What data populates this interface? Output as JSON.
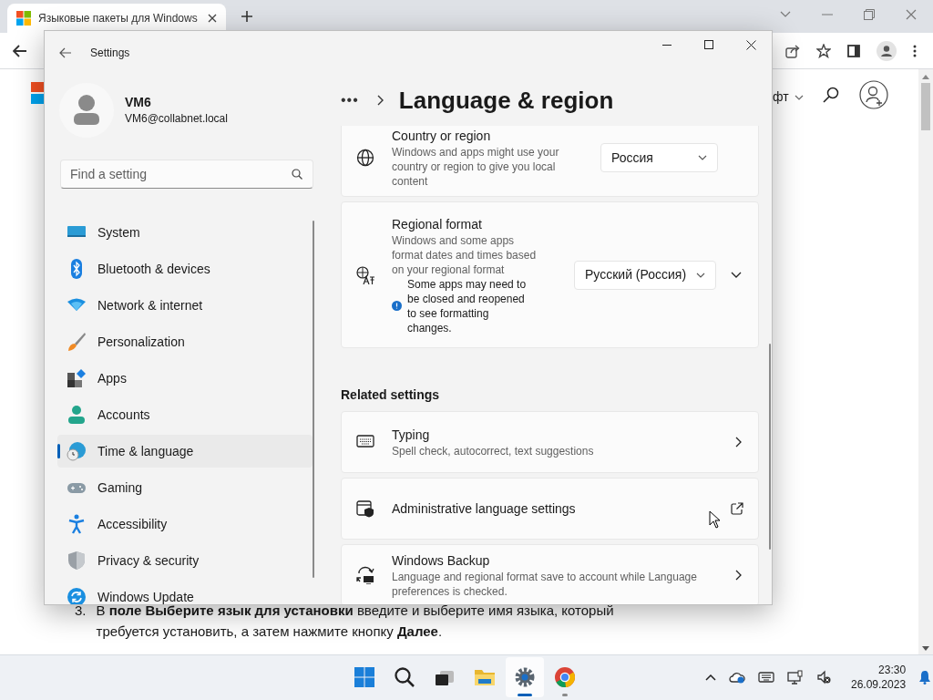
{
  "browser": {
    "tab": {
      "title": "Языковые пакеты для Windows"
    },
    "page": {
      "menu_text": "фт",
      "step_number": "3.",
      "step_text": "В **поле Выберите язык для установки** введите и выберите имя языка, который требуется установить, а затем нажмите кнопку **Далее**."
    }
  },
  "settings": {
    "title": "Settings",
    "user": {
      "name": "VM6",
      "email": "VM6@collabnet.local"
    },
    "search": {
      "placeholder": "Find a setting"
    },
    "nav": [
      {
        "label": "System",
        "selected": false
      },
      {
        "label": "Bluetooth & devices",
        "selected": false
      },
      {
        "label": "Network & internet",
        "selected": false
      },
      {
        "label": "Personalization",
        "selected": false
      },
      {
        "label": "Apps",
        "selected": false
      },
      {
        "label": "Accounts",
        "selected": false
      },
      {
        "label": "Time & language",
        "selected": true
      },
      {
        "label": "Gaming",
        "selected": false
      },
      {
        "label": "Accessibility",
        "selected": false
      },
      {
        "label": "Privacy & security",
        "selected": false
      },
      {
        "label": "Windows Update",
        "selected": false
      }
    ],
    "breadcrumb_more": "•••",
    "page_title": "Language & region",
    "region_cards": [
      {
        "title": "Country or region",
        "description": "Windows and apps might use your country or region to give you local content",
        "value": "Россия"
      },
      {
        "title": "Regional format",
        "description": "Windows and some apps format dates and times based on your regional format",
        "note": "Some apps may need to be closed and reopened to see formatting changes.",
        "value": "Русский (Россия)",
        "expanded": false
      }
    ],
    "related_heading": "Related settings",
    "related": [
      {
        "title": "Typing",
        "description": "Spell check, autocorrect, text suggestions",
        "kind": "chevron"
      },
      {
        "title": "Administrative language settings",
        "kind": "external"
      },
      {
        "title": "Windows Backup",
        "description": "Language and regional format save to account while Language preferences is checked.",
        "kind": "chevron"
      }
    ]
  },
  "taskbar": {
    "apps": [
      {
        "selected": false,
        "running": false
      },
      {
        "selected": false,
        "running": false
      },
      {
        "selected": false,
        "running": false
      },
      {
        "selected": false,
        "running": false
      },
      {
        "selected": true,
        "running": true
      },
      {
        "selected": false,
        "running": true
      }
    ],
    "clock": {
      "time": "23:30",
      "date": "26.09.2023"
    }
  }
}
